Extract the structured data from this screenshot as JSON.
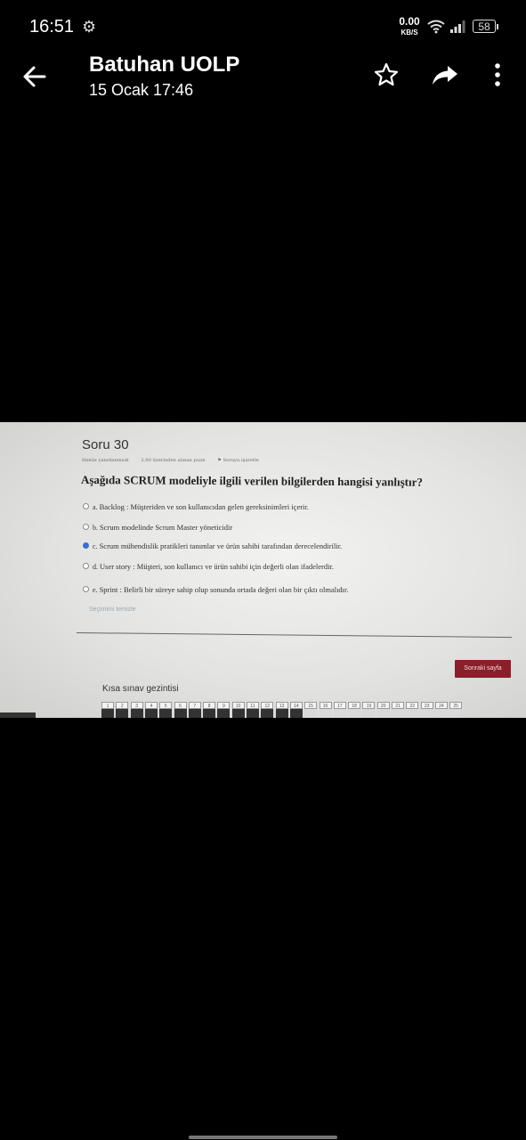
{
  "status_bar": {
    "time": "16:51",
    "net_speed_value": "0.00",
    "net_speed_unit": "KB/S",
    "battery": "58"
  },
  "app_bar": {
    "title": "Batuhan UOLP",
    "subtitle": "15 Ocak 17:46",
    "icons": [
      "back-arrow-icon",
      "star-icon",
      "share-icon",
      "more-vertical-icon"
    ]
  },
  "photo": {
    "question_label": "Soru 30",
    "meta": [
      "Henüz yanıtlanmadı",
      "2,00 üzerinden alınan puan",
      "Soruyu işaretle"
    ],
    "question_text": "Aşağıda SCRUM modeliyle ilgili verilen bilgilerden hangisi yanlıştır?",
    "options": [
      {
        "letter": "a.",
        "text": "Backlog : Müşteriden ve son kullanıcıdan gelen gereksinimleri içerir.",
        "selected": false
      },
      {
        "letter": "b.",
        "text": "Scrum modelinde Scrum Master yöneticidir",
        "selected": false
      },
      {
        "letter": "c.",
        "text": "Scrum mühendislik pratikleri tanımlar ve ürün sahibi tarafından derecelendirilir.",
        "selected": true
      },
      {
        "letter": "d.",
        "text": "User story : Müşteri, son kullanıcı ve ürün sahibi için değerli olan ifadelerdir.",
        "selected": false
      },
      {
        "letter": "e.",
        "text": "Sprint : Belirli bir süreye sahip olup sonunda ortada değeri olan bir çıktı olmalıdır.",
        "selected": false
      }
    ],
    "clear_choice": "Seçimimi temizle",
    "next_page": "Sonraki sayfa",
    "nav_title": "Kısa sınav gezintisi",
    "nav_numbers": [
      "1",
      "2",
      "3",
      "4",
      "5",
      "6",
      "7",
      "8",
      "9",
      "10",
      "11",
      "12",
      "13",
      "14",
      "15",
      "16",
      "17",
      "18",
      "19",
      "20",
      "21",
      "22",
      "23",
      "24",
      "25"
    ],
    "answered_count": 14
  }
}
